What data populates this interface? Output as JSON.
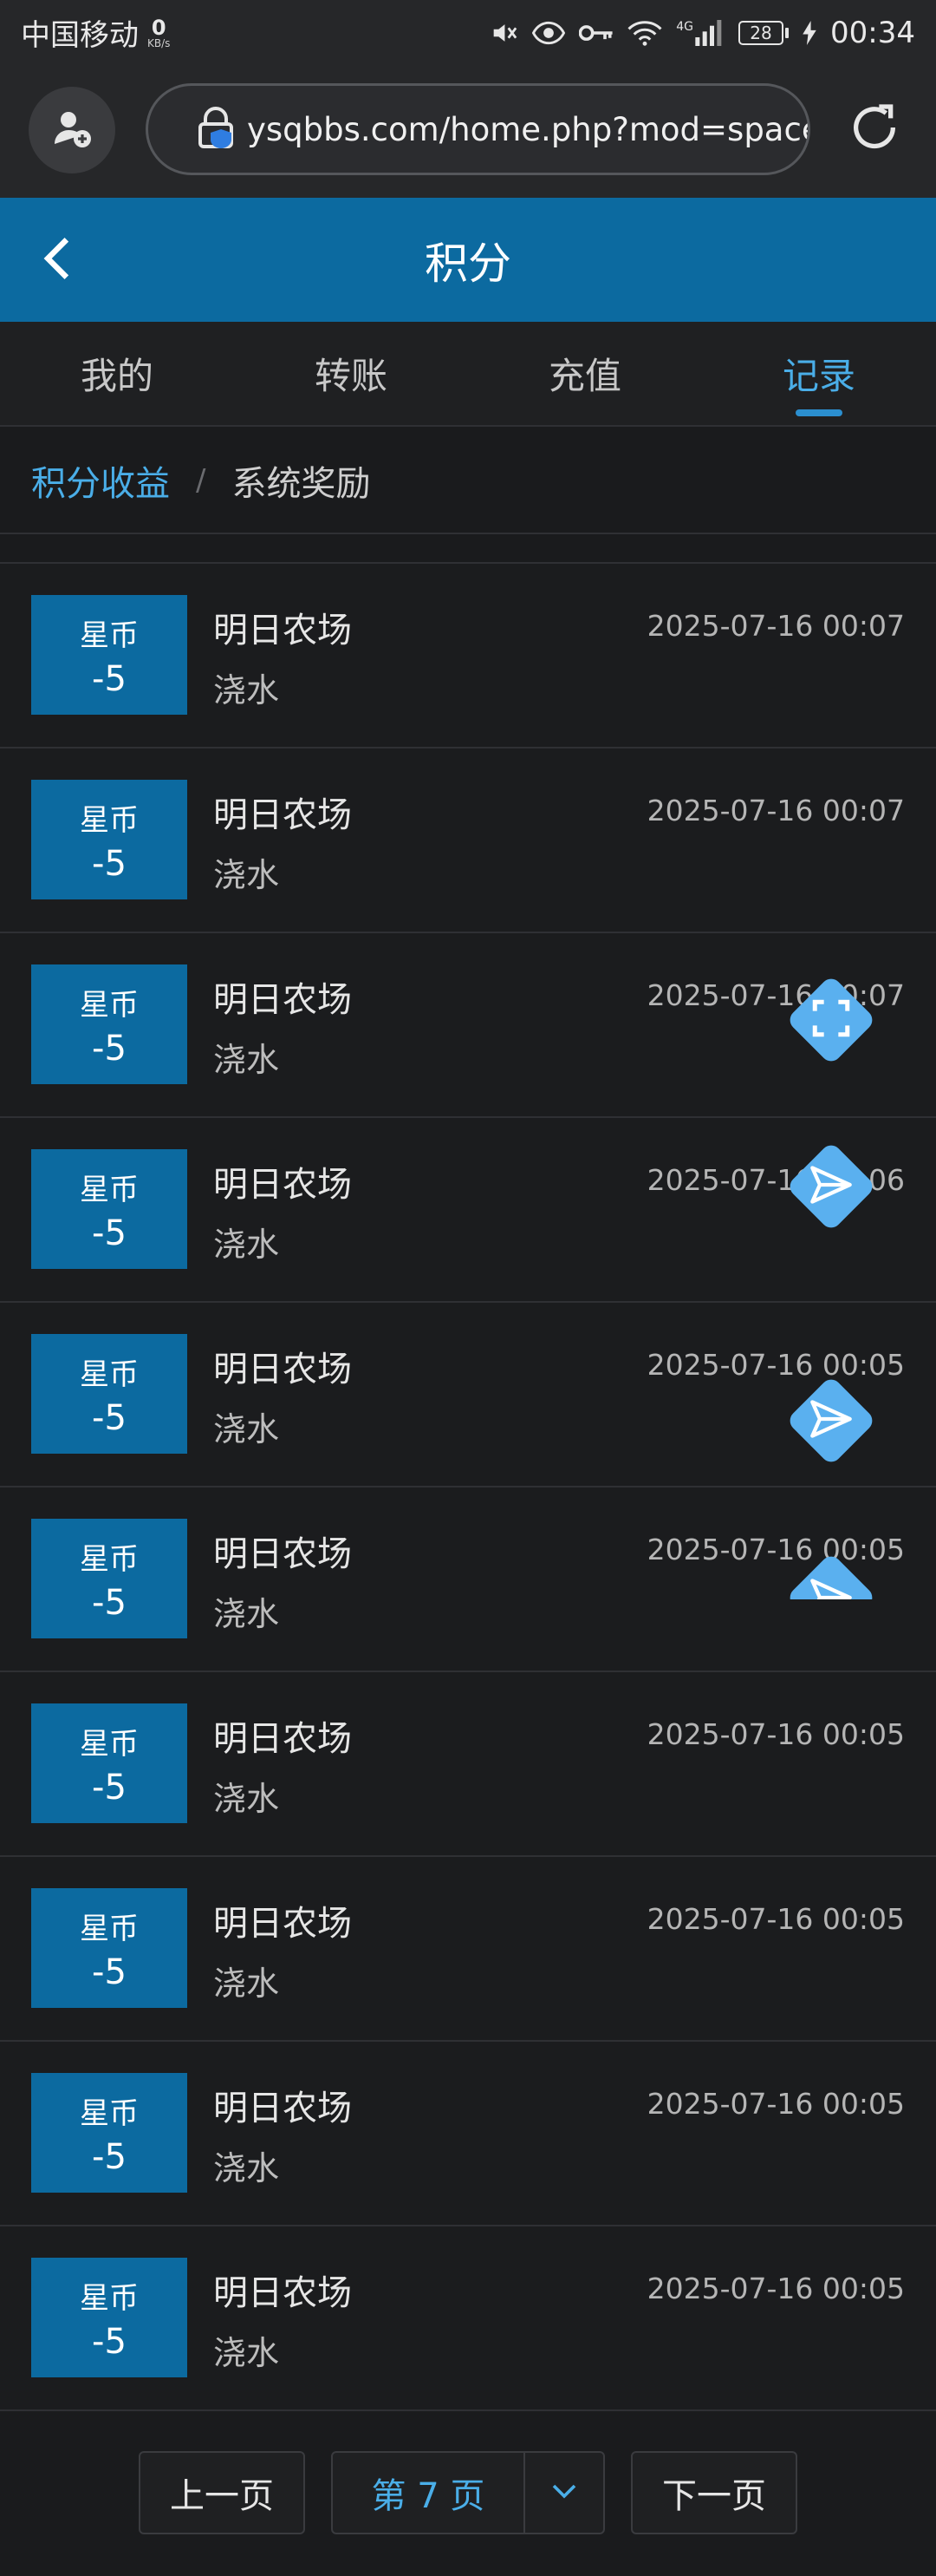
{
  "status_bar": {
    "carrier": "中国移动",
    "net_speed": "0",
    "net_unit": "KB/s",
    "network_type": "4G",
    "battery": "28",
    "time": "00:34"
  },
  "browser": {
    "url": "ysqbbs.com/home.php?mod=spacecp"
  },
  "header": {
    "title": "积分"
  },
  "tabs": [
    {
      "label": "我的"
    },
    {
      "label": "转账"
    },
    {
      "label": "充值"
    },
    {
      "label": "记录"
    }
  ],
  "breadcrumb": {
    "active": "积分收益",
    "separator": "/",
    "current": "系统奖励"
  },
  "records": [
    {
      "unit": "星币",
      "amount": "-5",
      "title": "明日农场",
      "desc": "浇水",
      "time": "2025-07-16 00:07"
    },
    {
      "unit": "星币",
      "amount": "-5",
      "title": "明日农场",
      "desc": "浇水",
      "time": "2025-07-16 00:07"
    },
    {
      "unit": "星币",
      "amount": "-5",
      "title": "明日农场",
      "desc": "浇水",
      "time": "2025-07-16 00:07"
    },
    {
      "unit": "星币",
      "amount": "-5",
      "title": "明日农场",
      "desc": "浇水",
      "time": "2025-07-16 00:06"
    },
    {
      "unit": "星币",
      "amount": "-5",
      "title": "明日农场",
      "desc": "浇水",
      "time": "2025-07-16 00:05"
    },
    {
      "unit": "星币",
      "amount": "-5",
      "title": "明日农场",
      "desc": "浇水",
      "time": "2025-07-16 00:05"
    },
    {
      "unit": "星币",
      "amount": "-5",
      "title": "明日农场",
      "desc": "浇水",
      "time": "2025-07-16 00:05"
    },
    {
      "unit": "星币",
      "amount": "-5",
      "title": "明日农场",
      "desc": "浇水",
      "time": "2025-07-16 00:05"
    },
    {
      "unit": "星币",
      "amount": "-5",
      "title": "明日农场",
      "desc": "浇水",
      "time": "2025-07-16 00:05"
    },
    {
      "unit": "星币",
      "amount": "-5",
      "title": "明日农场",
      "desc": "浇水",
      "time": "2025-07-16 00:05"
    }
  ],
  "pagination": {
    "prev": "上一页",
    "current": "第 7 页",
    "next": "下一页"
  },
  "floating_buttons": [
    {
      "icon": "fullscreen-icon"
    },
    {
      "icon": "send-icon"
    },
    {
      "icon": "send-icon"
    },
    {
      "icon": "send-icon"
    }
  ],
  "colors": {
    "accent": "#0c6aa0",
    "link": "#4aaee8",
    "fab": "#5ab0ef",
    "background": "#1a1b1d"
  }
}
